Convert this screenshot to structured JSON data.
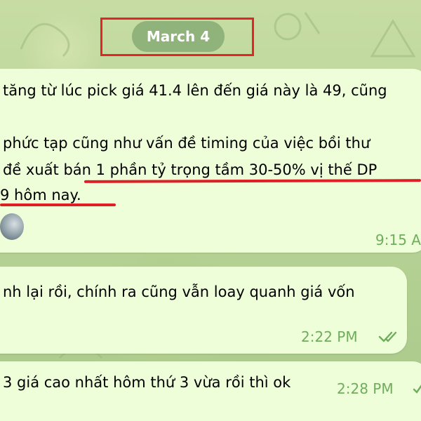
{
  "date_pill": {
    "label": "March 4"
  },
  "messages": [
    {
      "lines": [
        "tăng từ lúc pick giá 41.4 lên đến giá này là 49, cũng",
        "phức tạp cũng như vấn đề timing của việc bồi thư",
        "đề xuất bán 1 phần tỷ trọng tầm 30-50% vị thế DP",
        "9 hôm nay."
      ],
      "time": "9:15 A"
    },
    {
      "lines": [
        "nh lại rồi, chính ra cũng vẫn loay quanh giá vốn"
      ],
      "time": "2:22 PM"
    },
    {
      "lines": [
        "3 giá cao nhất hôm thứ 3 vừa rồi thì ok"
      ],
      "time": "2:28 PM"
    }
  ],
  "colors": {
    "bubble": "#eefed9",
    "timestamp": "#6fad5c",
    "annotation_red": "#e5242a",
    "date_pill": "#8fb37a"
  },
  "icons": [
    "double-check-icon",
    "single-check-icon",
    "avatar"
  ]
}
